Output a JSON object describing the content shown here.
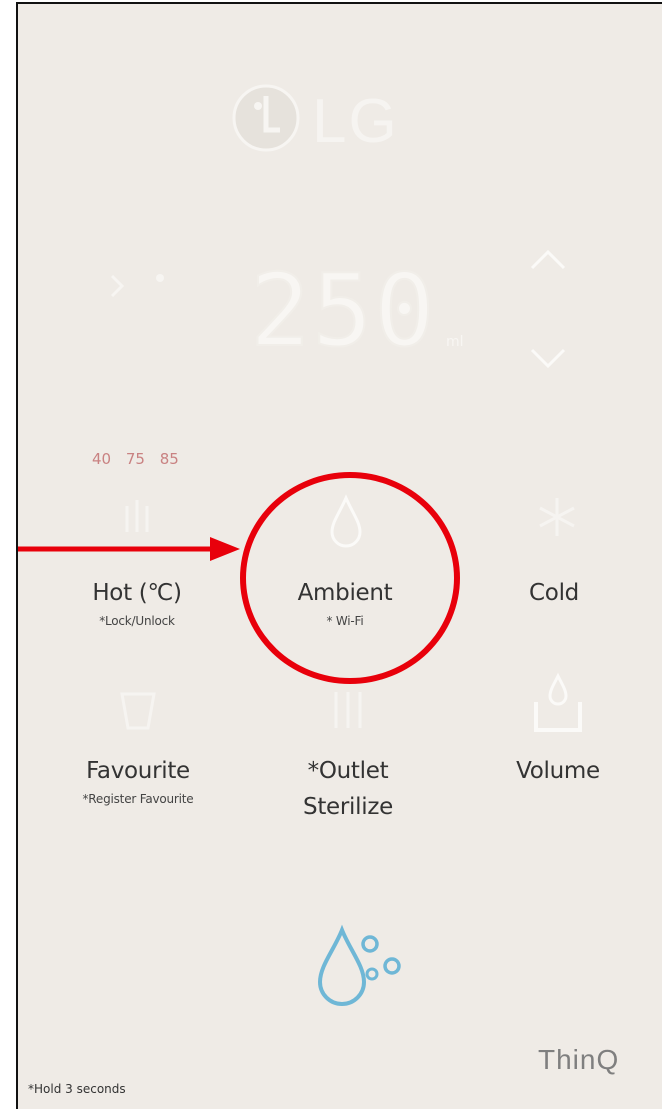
{
  "brand": {
    "logo_text": "LG"
  },
  "display": {
    "temperature": "250",
    "unit": "ml"
  },
  "presets": {
    "values": [
      "40",
      "75",
      "85"
    ],
    "color": "#c98282"
  },
  "buttons": {
    "hot": {
      "label": "Hot (℃)",
      "sub": "*Lock/Unlock"
    },
    "ambient": {
      "label": "Ambient",
      "sub": "* Wi-Fi"
    },
    "cold": {
      "label": "Cold",
      "sub": ""
    },
    "favourite": {
      "label": "Favourite",
      "sub": "*Register Favourite"
    },
    "outlet": {
      "label_line1": "*Outlet",
      "label_line2": "Sterilize"
    },
    "volume": {
      "label": "Volume"
    }
  },
  "footer": {
    "hold_note": "*Hold 3 seconds",
    "thinq": "ThinQ"
  },
  "icons": {
    "up": "chevron-up-icon",
    "down": "chevron-down-icon",
    "hot": "hot-water-icon",
    "ambient": "water-drop-icon",
    "cold": "snowflake-icon",
    "favourite": "cup-icon",
    "outlet": "outlet-icon",
    "volume": "volume-cup-icon",
    "sterilize": "water-bubbles-icon"
  },
  "colors": {
    "panel": "#efebe6",
    "highlight": "#e8000b",
    "sterilize": "#6fb7d6",
    "text": "#333333"
  }
}
